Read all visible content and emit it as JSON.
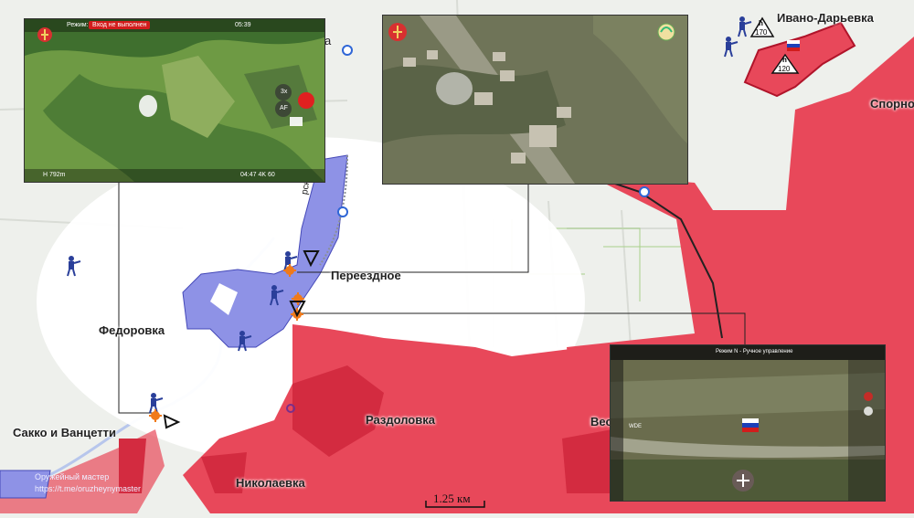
{
  "map": {
    "places": {
      "ivano_daryevka": "Ивано-Дарьевка",
      "sporno": "Спорно",
      "pereezdnoe": "Переездное",
      "fedorovka": "Федоровка",
      "razdolovka": "Раздоловка",
      "sakko": "Сакко и Ванцетти",
      "nikolaevka": "Николаевка",
      "ves": "Вес",
      "river_label": "рского",
      "a_fragment": "а"
    },
    "elevation_markers": [
      {
        "label": "h",
        "value": "170"
      },
      {
        "label": "h",
        "value": "120"
      }
    ],
    "scale_bar": "1.25 км",
    "watermark": {
      "line1": "Оружейный мастер",
      "line2": "https://t.me/oruzheynymaster"
    },
    "colors": {
      "russian_control": "#e8485a",
      "ukrainian_units": "#8e92e6",
      "unit_icon": "#2a3f9a",
      "highlight": "#ffffff",
      "base_map": "#eef0ec"
    }
  },
  "insets": {
    "drone_left": {
      "mode": "Режим: С",
      "status": "Вход не выполнен",
      "time": "05:39",
      "speed": "3x",
      "af": "AF",
      "altitude": "H 792m",
      "footer": "04:47 4K 60"
    },
    "drone_center": {},
    "drone_right": {
      "mode": "Режим N - Ручное управление",
      "mode_short": "WDE"
    }
  }
}
